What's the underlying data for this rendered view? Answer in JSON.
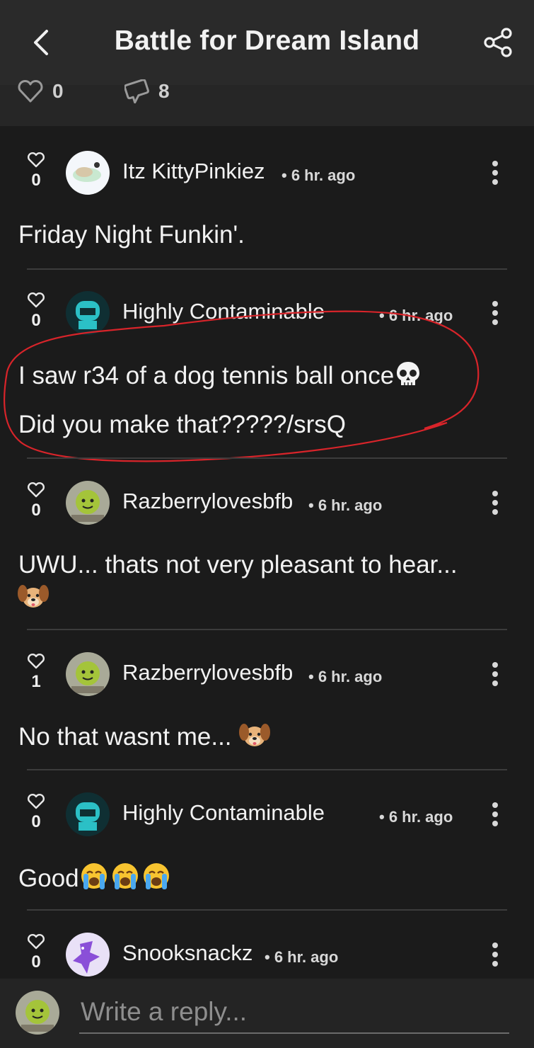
{
  "header": {
    "title": "Battle for Dream Island",
    "back_icon": "chevron-left-icon",
    "share_icon": "share-icon"
  },
  "stats": {
    "likes": "0",
    "replies": "8"
  },
  "comments": [
    {
      "user": "Itz KittyPinkiez",
      "time": "• 6 hr. ago",
      "likes": "0",
      "lines": [
        "Friday Night Funkin'."
      ]
    },
    {
      "user": "Highly Contaminable",
      "time": "• 6 hr. ago",
      "likes": "0",
      "lines": [
        "I saw r34 of a dog tennis ball once",
        "Did you make that?????/srsQ"
      ]
    },
    {
      "user": "Razberrylovesbfb",
      "time": "• 6 hr. ago",
      "likes": "0",
      "lines": [
        "UWU... thats not very pleasant to hear..."
      ]
    },
    {
      "user": "Razberrylovesbfb",
      "time": "• 6 hr. ago",
      "likes": "1",
      "lines": [
        "No that wasnt me... "
      ]
    },
    {
      "user": "Highly Contaminable",
      "time": "• 6 hr. ago",
      "likes": "0",
      "lines": [
        "Good"
      ]
    },
    {
      "user": "Snooksnackz",
      "time": "• 6 hr. ago",
      "likes": "0",
      "lines": []
    }
  ],
  "reply": {
    "placeholder": "Write a reply..."
  },
  "colors": {
    "background": "#1b1b1b",
    "header": "#2a2a2a",
    "annotation": "#d8242a"
  }
}
